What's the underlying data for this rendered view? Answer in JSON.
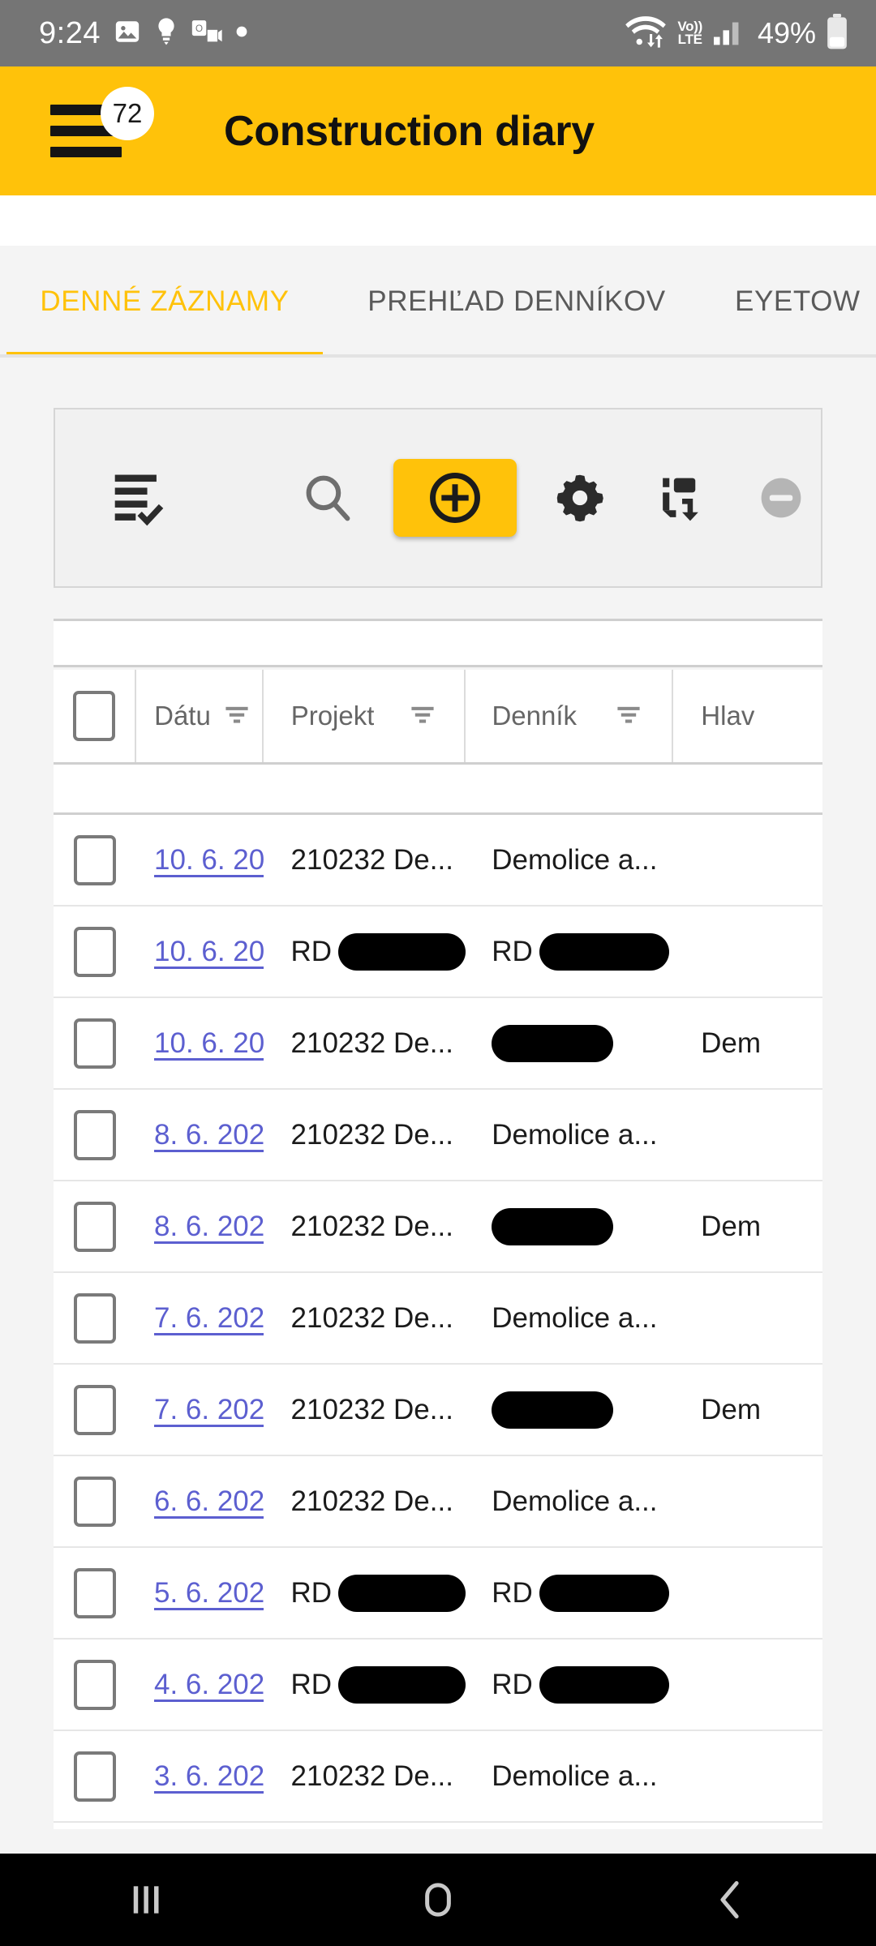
{
  "status_bar": {
    "time": "9:24",
    "icons": [
      "image-icon",
      "lightbulb-icon",
      "outlook-icon",
      "dot-icon"
    ],
    "network_icons": [
      "wifi-icon",
      "volte-icon",
      "signal-icon"
    ],
    "volte_line1": "Vo))",
    "volte_line2": "LTE",
    "battery_percent": "49%"
  },
  "appbar": {
    "menu_icon": "hamburger-menu-icon",
    "badge_count": "72",
    "title": "Construction diary",
    "background_color": "#FFC20A"
  },
  "tabs": {
    "items": [
      {
        "label": "DENNÉ ZÁZNAMY",
        "active": true
      },
      {
        "label": "PREHĽAD DENNÍKOV",
        "active": false
      },
      {
        "label": "EYETOW",
        "active": false
      }
    ],
    "active_color": "#FFC20A",
    "inactive_color": "#5A5A5A"
  },
  "toolbar": {
    "buttons": [
      {
        "name": "list-view-icon",
        "label": ""
      },
      {
        "name": "search-icon",
        "label": ""
      },
      {
        "name": "add-icon",
        "label": ""
      },
      {
        "name": "settings-gear-icon",
        "label": ""
      },
      {
        "name": "sync-icon",
        "label": ""
      },
      {
        "name": "remove-icon",
        "label": ""
      }
    ],
    "add_button_color": "#FFC20A"
  },
  "table": {
    "columns": [
      {
        "key": "select",
        "label": "",
        "filter": false
      },
      {
        "key": "date",
        "label": "Dátu",
        "filter": true
      },
      {
        "key": "project",
        "label": "Projekt",
        "filter": true
      },
      {
        "key": "diary",
        "label": "Denník",
        "filter": true
      },
      {
        "key": "main",
        "label": "Hlav",
        "filter": false
      }
    ],
    "rows": [
      {
        "date": "10. 6. 20",
        "project": "210232 De...",
        "diary": "Demolice a...",
        "main": "",
        "diary_redacted": false,
        "project_redacted": false
      },
      {
        "date": "10. 6. 20",
        "project": "RD",
        "diary": "RD",
        "main": "",
        "diary_redacted": true,
        "project_redacted": true
      },
      {
        "date": "10. 6. 20",
        "project": "210232 De...",
        "diary": "",
        "main": "Dem",
        "diary_redacted": true,
        "project_redacted": false
      },
      {
        "date": "8. 6. 202",
        "project": "210232 De...",
        "diary": "Demolice a...",
        "main": "",
        "diary_redacted": false,
        "project_redacted": false
      },
      {
        "date": "8. 6. 202",
        "project": "210232 De...",
        "diary": "",
        "main": "Dem",
        "diary_redacted": true,
        "project_redacted": false
      },
      {
        "date": "7. 6. 202",
        "project": "210232 De...",
        "diary": "Demolice a...",
        "main": "",
        "diary_redacted": false,
        "project_redacted": false
      },
      {
        "date": "7. 6. 202",
        "project": "210232 De...",
        "diary": "",
        "main": "Dem",
        "diary_redacted": true,
        "project_redacted": false
      },
      {
        "date": "6. 6. 202",
        "project": "210232 De...",
        "diary": "Demolice a...",
        "main": "",
        "diary_redacted": false,
        "project_redacted": false
      },
      {
        "date": "5. 6. 202",
        "project": "RD",
        "diary": "RD",
        "main": "",
        "diary_redacted": true,
        "project_redacted": true
      },
      {
        "date": "4. 6. 202",
        "project": "RD",
        "diary": "RD",
        "main": "",
        "diary_redacted": true,
        "project_redacted": true
      },
      {
        "date": "3. 6. 202",
        "project": "210232 De...",
        "diary": "Demolice a...",
        "main": "",
        "diary_redacted": false,
        "project_redacted": false
      }
    ],
    "link_color": "#5C5FD0"
  },
  "navbar": {
    "buttons": [
      {
        "name": "recents-button",
        "glyph": "|||"
      },
      {
        "name": "home-button",
        "glyph": "○"
      },
      {
        "name": "back-button",
        "glyph": "‹"
      }
    ]
  }
}
